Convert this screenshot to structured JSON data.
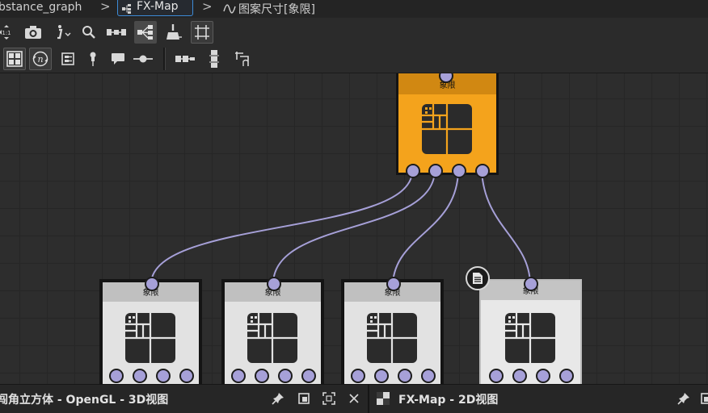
{
  "breadcrumb": {
    "graph": "bstance_graph",
    "fxmap": "FX-Map",
    "current": "图案尺寸[象限]",
    "sep": ">"
  },
  "icons": {
    "fxmap": "fx-map-icon",
    "current": "function-icon"
  },
  "nodes": {
    "top": {
      "label": "象限",
      "color": "#f4a31c",
      "header_color": "#d18812"
    },
    "children": [
      {
        "label": "象限"
      },
      {
        "label": "象限"
      },
      {
        "label": "象限"
      },
      {
        "label": "象限"
      }
    ]
  },
  "bottom": {
    "left_title": "闯角立方体 - OpenGL - 3D视图",
    "right_title": "FX-Map - 2D视图"
  },
  "colors": {
    "accent": "#3d8bd6",
    "pin": "#a6a0d8",
    "wire": "#a6a0d8",
    "node_body": "#e2e2e2",
    "node_header": "#c0c0c0"
  }
}
